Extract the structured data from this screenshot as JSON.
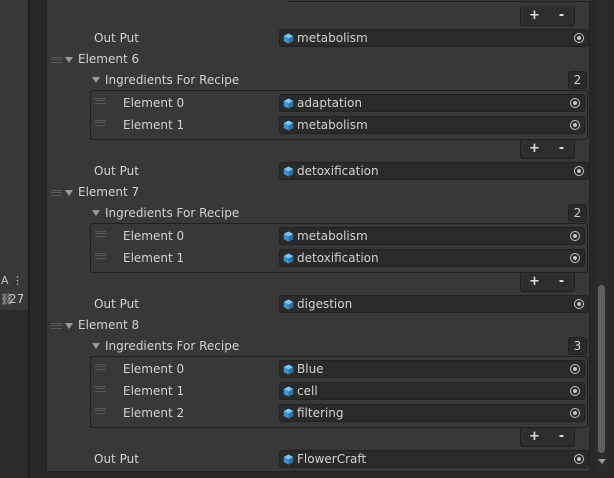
{
  "left_panel": {
    "tool_a": "A",
    "tool_more": "⋮",
    "link_glyph": "⛓",
    "count": "27"
  },
  "labels": {
    "out_put": "Out Put",
    "ingredients": "Ingredients For Recipe",
    "add": "+",
    "remove": "-"
  },
  "top": {
    "out_put_value": "metabolism"
  },
  "elements": [
    {
      "label": "Element 6",
      "size": "2",
      "items": [
        {
          "label": "Element 0",
          "value": "adaptation"
        },
        {
          "label": "Element 1",
          "value": "metabolism"
        }
      ],
      "out_put": "detoxification"
    },
    {
      "label": "Element 7",
      "size": "2",
      "items": [
        {
          "label": "Element 0",
          "value": "metabolism"
        },
        {
          "label": "Element 1",
          "value": "detoxification"
        }
      ],
      "out_put": "digestion"
    },
    {
      "label": "Element 8",
      "size": "3",
      "items": [
        {
          "label": "Element 0",
          "value": "Blue"
        },
        {
          "label": "Element 1",
          "value": "cell"
        },
        {
          "label": "Element 2",
          "value": "filtering"
        }
      ],
      "out_put": "FlowerCraft"
    }
  ],
  "colors": {
    "object_icon": "#4aa3df",
    "panel": "#383838",
    "field": "#2a2a2a"
  }
}
